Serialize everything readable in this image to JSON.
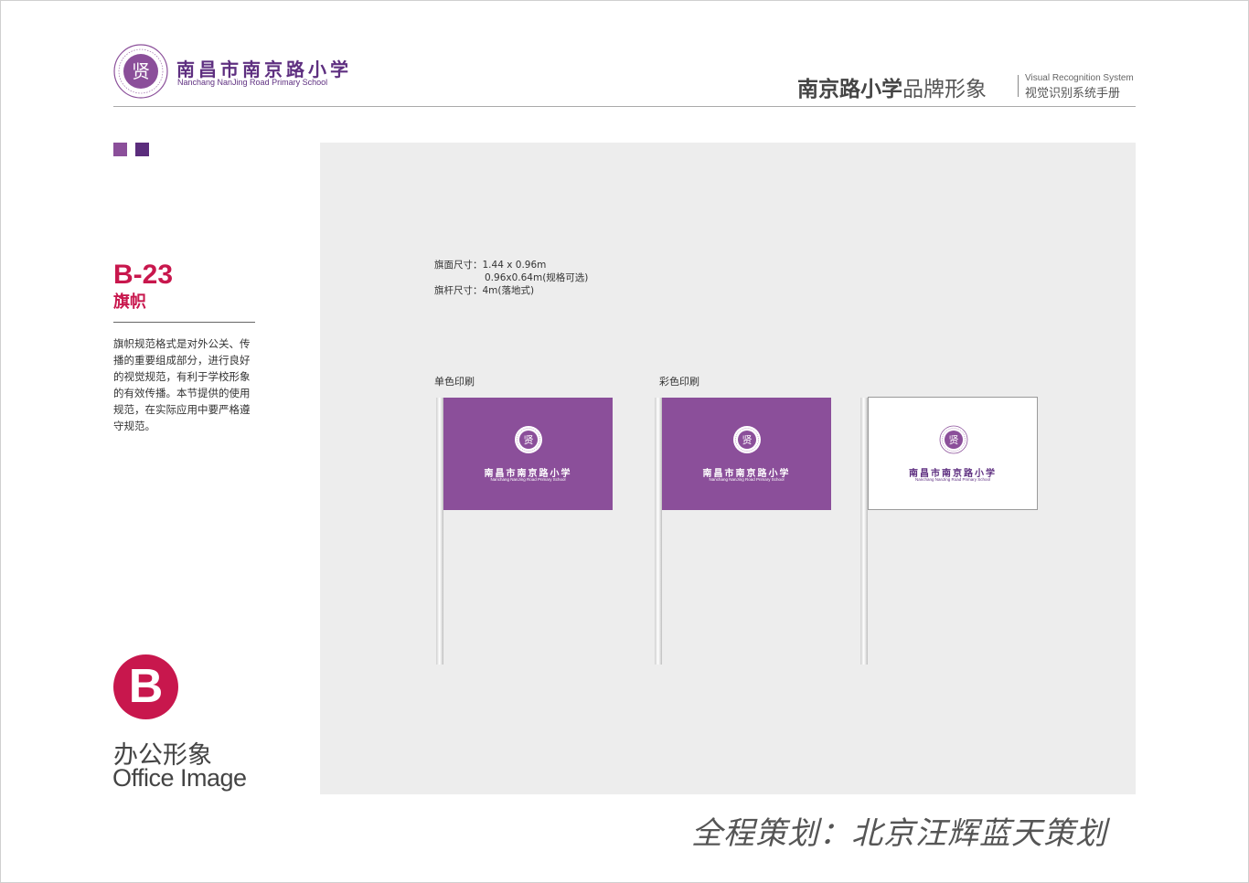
{
  "header": {
    "school_name_cn": "南昌市南京路小学",
    "school_name_en": "Nanchang NanJing Road Primary School",
    "emblem_char": "贤",
    "brand_title_bold": "南京路小学",
    "brand_title_rest": "品牌形象",
    "brand_en": "Visual Recognition System",
    "brand_cn": "视觉识别系统手册"
  },
  "section": {
    "code": "B-23",
    "name": "旗帜",
    "description": "旗帜规范格式是对外公关、传播的重要组成部分，进行良好的视觉规范，有利于学校形象的有效传播。本节提供的使用规范，在实际应用中要严格遵守规范。",
    "part_letter": "B",
    "part_cn": "办公形象",
    "part_en": "Office Image"
  },
  "specs": {
    "line1": "旗面尺寸：1.44 x 0.96m",
    "line2": "0.96x0.64m(规格可选)",
    "line3": "旗杆尺寸：4m(落地式)"
  },
  "captions": {
    "mono": "单色印刷",
    "color": "彩色印刷"
  },
  "flags": [
    {
      "style": "purple",
      "name_cn": "南昌市南京路小学",
      "name_en": "Nanchang NanJing Road Primary School"
    },
    {
      "style": "purple",
      "name_cn": "南昌市南京路小学",
      "name_en": "Nanchang NanJing Road Primary School"
    },
    {
      "style": "white",
      "name_cn": "南昌市南京路小学",
      "name_en": "Nanchang NanJing Road Primary School"
    }
  ],
  "colors": {
    "brand_purple": "#8b4f9a",
    "deep_purple": "#5b2d7c",
    "accent_red": "#c8174d",
    "panel_gray": "#ededed"
  },
  "footer": {
    "credit": "全程策划：北京汪辉蓝天策划"
  }
}
